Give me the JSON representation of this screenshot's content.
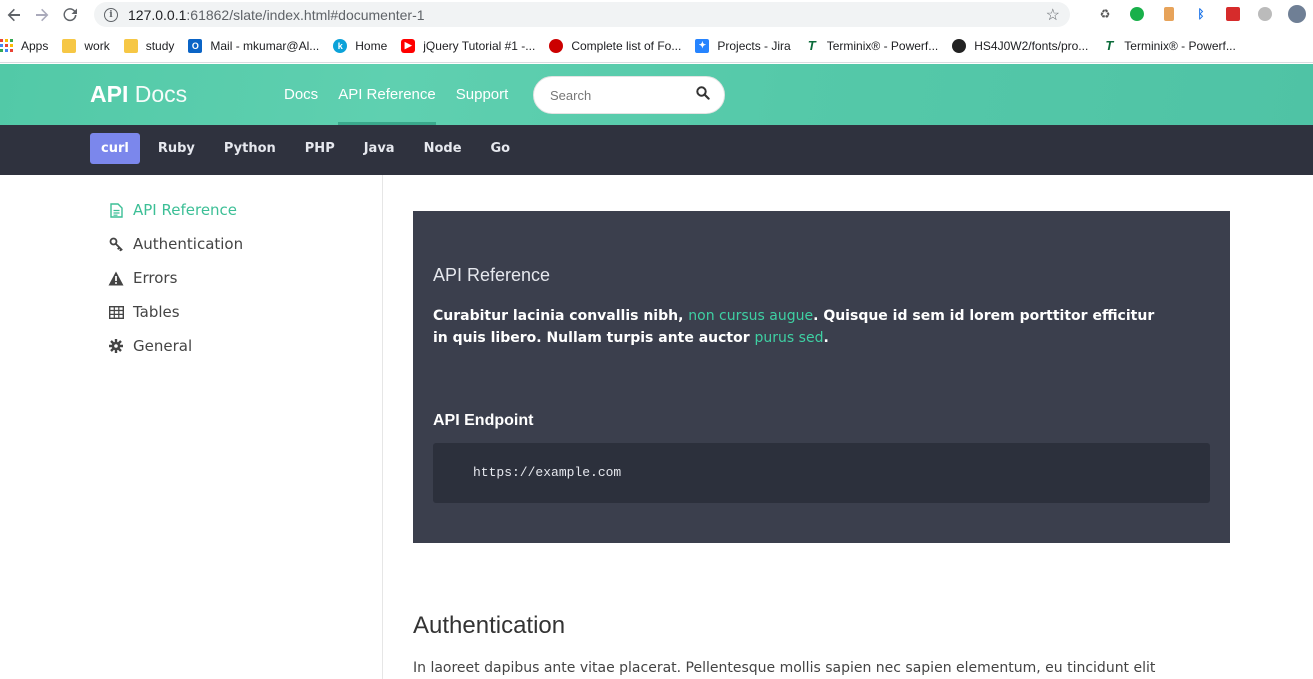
{
  "browser": {
    "url_host": "127.0.0.1",
    "url_rest": ":61862/slate/index.html#documenter-1",
    "bookmarks": [
      {
        "label": "Apps",
        "color": "#4285f4"
      },
      {
        "label": "work",
        "color": "#f6c745"
      },
      {
        "label": "study",
        "color": "#f6c745"
      },
      {
        "label": "Mail - mkumar@Al...",
        "color": "#0a64c6"
      },
      {
        "label": "Home",
        "color": "#0ba2d9"
      },
      {
        "label": "jQuery Tutorial #1 -...",
        "color": "#ff0000"
      },
      {
        "label": "Complete list of Fo...",
        "color": "#c00"
      },
      {
        "label": "Projects - Jira",
        "color": "#2684ff"
      },
      {
        "label": "Terminix® - Powerf...",
        "color": "#0b6b3a"
      },
      {
        "label": "HS4J0W2/fonts/pro...",
        "color": "#222"
      },
      {
        "label": "Terminix® - Powerf...",
        "color": "#0b6b3a"
      }
    ]
  },
  "header": {
    "logo_bold": "API",
    "logo_light": "Docs",
    "nav": [
      "Docs",
      "API Reference",
      "Support"
    ],
    "search_placeholder": "Search"
  },
  "languages": [
    "curl",
    "Ruby",
    "Python",
    "PHP",
    "Java",
    "Node",
    "Go"
  ],
  "sidebar": {
    "items": [
      {
        "label": "API Reference",
        "icon": "document-icon"
      },
      {
        "label": "Authentication",
        "icon": "key-icon"
      },
      {
        "label": "Errors",
        "icon": "warning-icon"
      },
      {
        "label": "Tables",
        "icon": "table-icon"
      },
      {
        "label": "General",
        "icon": "gear-icon"
      }
    ]
  },
  "content": {
    "block_title": "API Reference",
    "para_part1": "Curabitur lacinia convallis nibh, ",
    "para_link1": "non cursus augue",
    "para_part2": ". Quisque id sem id lorem porttitor efficitur in quis libero. Nullam turpis ante auctor ",
    "para_link2": "purus sed",
    "para_part3": ".",
    "endpoint_title": "API Endpoint",
    "endpoint_url": "https://example.com",
    "section_title": "Authentication",
    "section_para": "In laoreet dapibus ante vitae placerat. Pellentesque mollis sapien nec sapien elementum, eu tincidunt elit"
  },
  "colors": {
    "accent": "#52c9a7",
    "lang_active": "#7b87ec",
    "dark_block": "#3b3f4d",
    "link": "#3ed0a3"
  }
}
